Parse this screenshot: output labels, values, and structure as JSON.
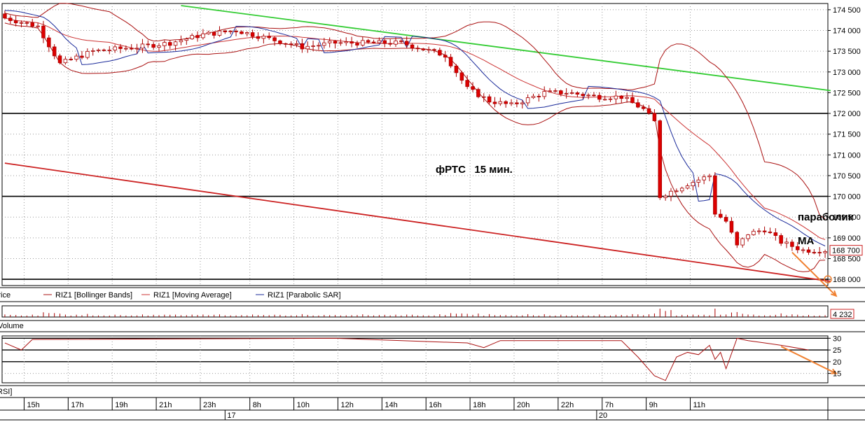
{
  "chart_data": {
    "type": "candlestick",
    "annotation": "фРТС   15 мин.",
    "annotations_right": {
      "sar": "параболик",
      "ma": "МА"
    },
    "price_axis": {
      "ylim": [
        167850,
        174650
      ],
      "ticks": [
        168000,
        168500,
        169000,
        169500,
        170000,
        170500,
        171000,
        171500,
        172000,
        172500,
        173000,
        173500,
        174000,
        174500
      ],
      "tick_labels": [
        "168 000",
        "168 500",
        "169 000",
        "169 500",
        "170 000",
        "170 500",
        "171 000",
        "171 500",
        "172 000",
        "172 500",
        "173 000",
        "173 500",
        "174 000",
        "174 500"
      ],
      "current_price_label": "168 700",
      "current_price": 168700
    },
    "horizontal_levels": [
      172000,
      170000,
      168000
    ],
    "trendlines": [
      {
        "color": "#33cc33",
        "start": [
          32,
          174600
        ],
        "end": [
          150,
          172550
        ]
      },
      {
        "color": "#cc2222",
        "start": [
          0,
          170800
        ],
        "end": [
          150,
          167950
        ]
      }
    ],
    "bar_count": 150,
    "key_closes": [
      [
        0,
        174300
      ],
      [
        6,
        174100
      ],
      [
        10,
        173200
      ],
      [
        16,
        173500
      ],
      [
        24,
        173600
      ],
      [
        30,
        173700
      ],
      [
        36,
        173900
      ],
      [
        42,
        174000
      ],
      [
        48,
        173800
      ],
      [
        54,
        173600
      ],
      [
        60,
        173700
      ],
      [
        66,
        173700
      ],
      [
        72,
        173700
      ],
      [
        80,
        173400
      ],
      [
        84,
        172600
      ],
      [
        88,
        172300
      ],
      [
        92,
        172200
      ],
      [
        98,
        172500
      ],
      [
        102,
        172500
      ],
      [
        108,
        172400
      ],
      [
        112,
        172400
      ],
      [
        116,
        172100
      ],
      [
        118,
        171800
      ],
      [
        119,
        170000
      ],
      [
        124,
        170300
      ],
      [
        128,
        170500
      ],
      [
        129,
        169600
      ],
      [
        131,
        169400
      ],
      [
        133,
        168800
      ],
      [
        135,
        169100
      ],
      [
        138,
        169200
      ],
      [
        141,
        168900
      ],
      [
        143,
        168800
      ],
      [
        145,
        168700
      ]
    ],
    "legend": [
      "Price",
      "RIZ1 [Bollinger Bands]",
      "RIZ1 [Moving Average]",
      "RIZ1 [Parabolic SAR]"
    ],
    "volume": {
      "label": "Volume",
      "last_value_label": "4 232"
    },
    "rsi": {
      "label": "RSI]",
      "ticks": [
        15,
        20,
        25,
        30
      ],
      "ylim": [
        11,
        31
      ],
      "levels": [
        20,
        25,
        30
      ],
      "key_points": [
        [
          0,
          28
        ],
        [
          3,
          25
        ],
        [
          5,
          29.5
        ],
        [
          60,
          30
        ],
        [
          84,
          28
        ],
        [
          87,
          26
        ],
        [
          90,
          29
        ],
        [
          112,
          29
        ],
        [
          115,
          22
        ],
        [
          118,
          14
        ],
        [
          120,
          12
        ],
        [
          122,
          22
        ],
        [
          124,
          24
        ],
        [
          126,
          23
        ],
        [
          128,
          27
        ],
        [
          129,
          21
        ],
        [
          130,
          24
        ],
        [
          131,
          17
        ],
        [
          133,
          30
        ],
        [
          135,
          29
        ],
        [
          138,
          28
        ],
        [
          141,
          27
        ],
        [
          146,
          25
        ]
      ],
      "forecast_arrow": {
        "from": [
          141,
          26.5
        ],
        "to": [
          151,
          15
        ]
      }
    },
    "forecast_arrow_price": {
      "from": [
        143,
        168650
      ],
      "to": [
        151,
        167600
      ]
    },
    "time_axis": {
      "labels": [
        "15h",
        "17h",
        "19h",
        "21h",
        "23h",
        "8h",
        "10h",
        "12h",
        "14h",
        "16h",
        "18h",
        "20h",
        "22h",
        "7h",
        "9h",
        "11h"
      ],
      "label_bar_index": [
        4,
        12,
        20,
        28,
        36,
        45,
        53,
        61,
        69,
        77,
        85,
        93,
        101,
        109,
        117,
        125
      ],
      "day_labels": [
        {
          "label": "17",
          "bar_index": 40
        },
        {
          "label": "20",
          "bar_index": 107.5
        }
      ]
    },
    "colors": {
      "up": "#ffffff",
      "down": "#dd0000",
      "wick": "#aa0000",
      "bollinger": "#aa1111",
      "ma": "#cc3333",
      "sar": "#1a2a9a",
      "forecast": "#f08030",
      "green_trend": "#33cc33",
      "red_trend": "#cc2222"
    }
  }
}
